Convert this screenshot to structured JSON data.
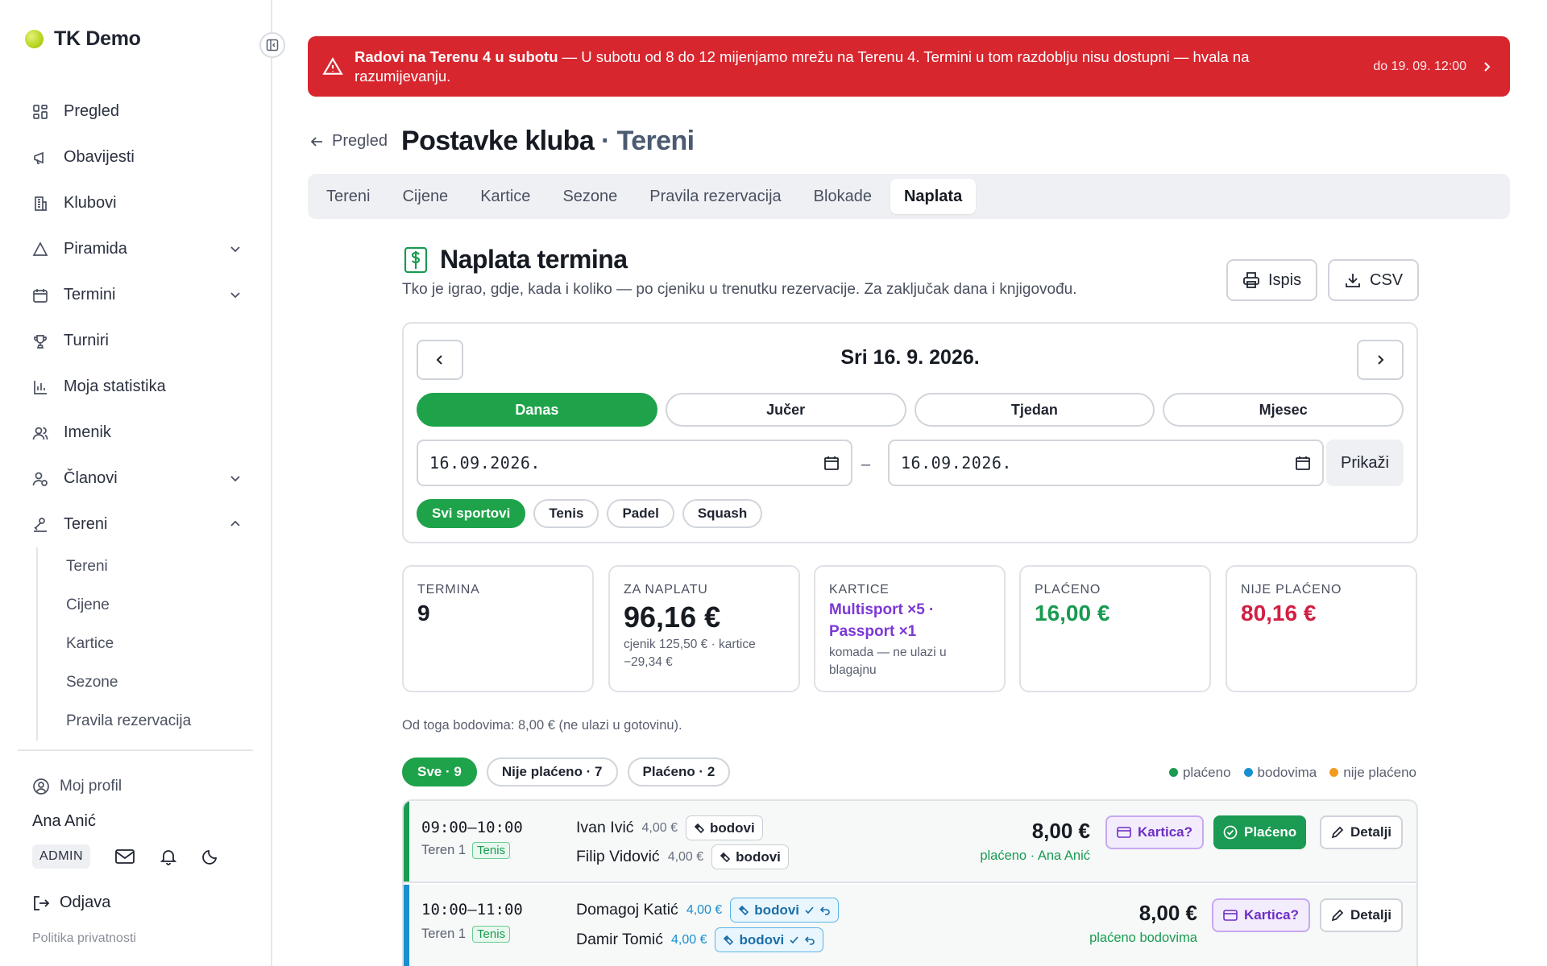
{
  "app": {
    "name": "TK Demo"
  },
  "sidebar": {
    "items": [
      {
        "label": "Pregled",
        "icon": "dashboard-icon"
      },
      {
        "label": "Obavijesti",
        "icon": "megaphone-icon"
      },
      {
        "label": "Klubovi",
        "icon": "building-icon"
      },
      {
        "label": "Piramida",
        "icon": "triangle-icon",
        "expandable": true
      },
      {
        "label": "Termini",
        "icon": "calendar-icon",
        "expandable": true
      },
      {
        "label": "Turniri",
        "icon": "trophy-icon"
      },
      {
        "label": "Moja statistika",
        "icon": "bar-chart-icon"
      },
      {
        "label": "Imenik",
        "icon": "contacts-icon"
      },
      {
        "label": "Članovi",
        "icon": "members-icon",
        "expandable": true
      },
      {
        "label": "Tereni",
        "icon": "court-icon",
        "expanded": true
      }
    ],
    "sub_items": [
      "Tereni",
      "Cijene",
      "Kartice",
      "Sezone",
      "Pravila rezervacija"
    ],
    "profile_label": "Moj profil",
    "user_name": "Ana Anić",
    "role": "ADMIN",
    "logout": "Odjava",
    "privacy": "Politika privatnosti"
  },
  "alert": {
    "title": "Radovi na Terenu 4 u subotu",
    "message": " — U subotu od 8 do 12 mijenjamo mrežu na Terenu 4. Termini u tom razdoblju nisu dostupni — hvala na razumijevanju.",
    "until": "do 19. 09. 12:00",
    "color": "#d8262f"
  },
  "breadcrumb": {
    "back": "Pregled"
  },
  "page": {
    "title": "Postavke kluba",
    "separator": " · ",
    "subtitle": "Tereni"
  },
  "tabs": [
    "Tereni",
    "Cijene",
    "Kartice",
    "Sezone",
    "Pravila rezervacija",
    "Blokade",
    "Naplata"
  ],
  "active_tab": "Naplata",
  "section": {
    "title": "Naplata termina",
    "subtitle": "Tko je igrao, gdje, kada i koliko — po cjeniku u trenutku rezervacije. Za zaključak dana i knjigovođu.",
    "print": "Ispis",
    "csv": "CSV"
  },
  "filters": {
    "date_title": "Sri 16. 9. 2026.",
    "periods": [
      "Danas",
      "Jučer",
      "Tjedan",
      "Mjesec"
    ],
    "active_period": "Danas",
    "date_from": "16.09.2026.",
    "date_to": "16.09.2026.",
    "dash": "–",
    "show": "Prikaži",
    "sports": [
      "Svi sportovi",
      "Tenis",
      "Padel",
      "Squash"
    ],
    "active_sport": "Svi sportovi"
  },
  "stats": {
    "termina": {
      "label": "TERMINA",
      "value": "9"
    },
    "za_naplatu": {
      "label": "ZA NAPLATU",
      "value": "96,16 €",
      "note": "cjenik 125,50 € · kartice −29,34 €"
    },
    "kartice": {
      "label": "KARTICE",
      "value": "Multisport ×5 · Passport ×1",
      "note": "komada — ne ulazi u blagajnu"
    },
    "placeno": {
      "label": "PLAĆENO",
      "value": "16,00 €"
    },
    "nije_placeno": {
      "label": "NIJE PLAĆENO",
      "value": "80,16 €"
    }
  },
  "points_note": "Od toga bodovima: 8,00 € (ne ulazi u gotovinu).",
  "list_filters": [
    "Sve · 9",
    "Nije plaćeno · 7",
    "Plaćeno · 2"
  ],
  "legend": [
    {
      "label": "plaćeno",
      "color": "#1a9a52"
    },
    {
      "label": "bodovima",
      "color": "#1a8fd0"
    },
    {
      "label": "nije plaćeno",
      "color": "#f29b1d"
    }
  ],
  "bookings": [
    {
      "time": "09:00–10:00",
      "court": "Teren 1",
      "sport": "Tenis",
      "players": [
        {
          "name": "Ivan Ivić",
          "price": "4,00 €",
          "tag": "bodovi"
        },
        {
          "name": "Filip Vidović",
          "price": "4,00 €",
          "tag": "bodovi"
        }
      ],
      "amount": "8,00 €",
      "status": "plaćeno · Ana Anić",
      "card_btn": "Kartica?",
      "paid_btn": "Plaćeno",
      "details_btn": "Detalji"
    },
    {
      "time": "10:00–11:00",
      "court": "Teren 1",
      "sport": "Tenis",
      "players": [
        {
          "name": "Domagoj Katić",
          "price": "4,00 €",
          "tag": "bodovi"
        },
        {
          "name": "Damir Tomić",
          "price": "4,00 €",
          "tag": "bodovi"
        }
      ],
      "amount": "8,00 €",
      "status": "plaćeno bodovima",
      "card_btn": "Kartica?",
      "details_btn": "Detalji"
    }
  ]
}
